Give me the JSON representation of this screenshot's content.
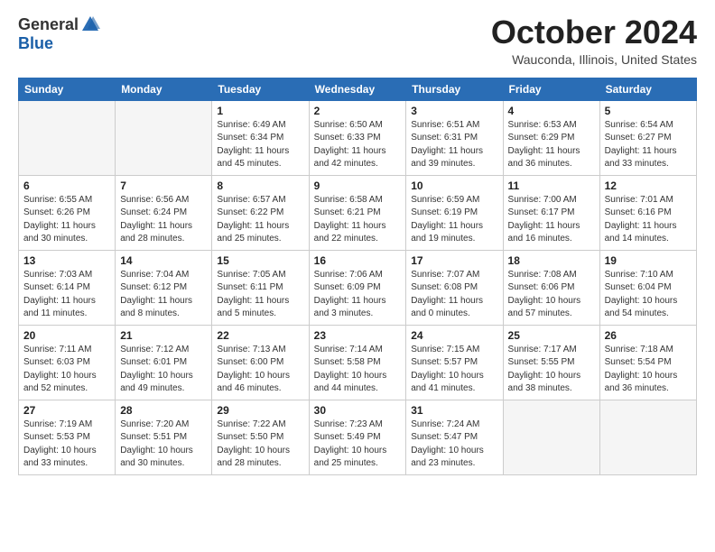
{
  "header": {
    "logo_general": "General",
    "logo_blue": "Blue",
    "month": "October 2024",
    "location": "Wauconda, Illinois, United States"
  },
  "days_of_week": [
    "Sunday",
    "Monday",
    "Tuesday",
    "Wednesday",
    "Thursday",
    "Friday",
    "Saturday"
  ],
  "weeks": [
    [
      {
        "day": "",
        "empty": true
      },
      {
        "day": "",
        "empty": true
      },
      {
        "day": "1",
        "sunrise": "Sunrise: 6:49 AM",
        "sunset": "Sunset: 6:34 PM",
        "daylight": "Daylight: 11 hours and 45 minutes."
      },
      {
        "day": "2",
        "sunrise": "Sunrise: 6:50 AM",
        "sunset": "Sunset: 6:33 PM",
        "daylight": "Daylight: 11 hours and 42 minutes."
      },
      {
        "day": "3",
        "sunrise": "Sunrise: 6:51 AM",
        "sunset": "Sunset: 6:31 PM",
        "daylight": "Daylight: 11 hours and 39 minutes."
      },
      {
        "day": "4",
        "sunrise": "Sunrise: 6:53 AM",
        "sunset": "Sunset: 6:29 PM",
        "daylight": "Daylight: 11 hours and 36 minutes."
      },
      {
        "day": "5",
        "sunrise": "Sunrise: 6:54 AM",
        "sunset": "Sunset: 6:27 PM",
        "daylight": "Daylight: 11 hours and 33 minutes."
      }
    ],
    [
      {
        "day": "6",
        "sunrise": "Sunrise: 6:55 AM",
        "sunset": "Sunset: 6:26 PM",
        "daylight": "Daylight: 11 hours and 30 minutes."
      },
      {
        "day": "7",
        "sunrise": "Sunrise: 6:56 AM",
        "sunset": "Sunset: 6:24 PM",
        "daylight": "Daylight: 11 hours and 28 minutes."
      },
      {
        "day": "8",
        "sunrise": "Sunrise: 6:57 AM",
        "sunset": "Sunset: 6:22 PM",
        "daylight": "Daylight: 11 hours and 25 minutes."
      },
      {
        "day": "9",
        "sunrise": "Sunrise: 6:58 AM",
        "sunset": "Sunset: 6:21 PM",
        "daylight": "Daylight: 11 hours and 22 minutes."
      },
      {
        "day": "10",
        "sunrise": "Sunrise: 6:59 AM",
        "sunset": "Sunset: 6:19 PM",
        "daylight": "Daylight: 11 hours and 19 minutes."
      },
      {
        "day": "11",
        "sunrise": "Sunrise: 7:00 AM",
        "sunset": "Sunset: 6:17 PM",
        "daylight": "Daylight: 11 hours and 16 minutes."
      },
      {
        "day": "12",
        "sunrise": "Sunrise: 7:01 AM",
        "sunset": "Sunset: 6:16 PM",
        "daylight": "Daylight: 11 hours and 14 minutes."
      }
    ],
    [
      {
        "day": "13",
        "sunrise": "Sunrise: 7:03 AM",
        "sunset": "Sunset: 6:14 PM",
        "daylight": "Daylight: 11 hours and 11 minutes."
      },
      {
        "day": "14",
        "sunrise": "Sunrise: 7:04 AM",
        "sunset": "Sunset: 6:12 PM",
        "daylight": "Daylight: 11 hours and 8 minutes."
      },
      {
        "day": "15",
        "sunrise": "Sunrise: 7:05 AM",
        "sunset": "Sunset: 6:11 PM",
        "daylight": "Daylight: 11 hours and 5 minutes."
      },
      {
        "day": "16",
        "sunrise": "Sunrise: 7:06 AM",
        "sunset": "Sunset: 6:09 PM",
        "daylight": "Daylight: 11 hours and 3 minutes."
      },
      {
        "day": "17",
        "sunrise": "Sunrise: 7:07 AM",
        "sunset": "Sunset: 6:08 PM",
        "daylight": "Daylight: 11 hours and 0 minutes."
      },
      {
        "day": "18",
        "sunrise": "Sunrise: 7:08 AM",
        "sunset": "Sunset: 6:06 PM",
        "daylight": "Daylight: 10 hours and 57 minutes."
      },
      {
        "day": "19",
        "sunrise": "Sunrise: 7:10 AM",
        "sunset": "Sunset: 6:04 PM",
        "daylight": "Daylight: 10 hours and 54 minutes."
      }
    ],
    [
      {
        "day": "20",
        "sunrise": "Sunrise: 7:11 AM",
        "sunset": "Sunset: 6:03 PM",
        "daylight": "Daylight: 10 hours and 52 minutes."
      },
      {
        "day": "21",
        "sunrise": "Sunrise: 7:12 AM",
        "sunset": "Sunset: 6:01 PM",
        "daylight": "Daylight: 10 hours and 49 minutes."
      },
      {
        "day": "22",
        "sunrise": "Sunrise: 7:13 AM",
        "sunset": "Sunset: 6:00 PM",
        "daylight": "Daylight: 10 hours and 46 minutes."
      },
      {
        "day": "23",
        "sunrise": "Sunrise: 7:14 AM",
        "sunset": "Sunset: 5:58 PM",
        "daylight": "Daylight: 10 hours and 44 minutes."
      },
      {
        "day": "24",
        "sunrise": "Sunrise: 7:15 AM",
        "sunset": "Sunset: 5:57 PM",
        "daylight": "Daylight: 10 hours and 41 minutes."
      },
      {
        "day": "25",
        "sunrise": "Sunrise: 7:17 AM",
        "sunset": "Sunset: 5:55 PM",
        "daylight": "Daylight: 10 hours and 38 minutes."
      },
      {
        "day": "26",
        "sunrise": "Sunrise: 7:18 AM",
        "sunset": "Sunset: 5:54 PM",
        "daylight": "Daylight: 10 hours and 36 minutes."
      }
    ],
    [
      {
        "day": "27",
        "sunrise": "Sunrise: 7:19 AM",
        "sunset": "Sunset: 5:53 PM",
        "daylight": "Daylight: 10 hours and 33 minutes."
      },
      {
        "day": "28",
        "sunrise": "Sunrise: 7:20 AM",
        "sunset": "Sunset: 5:51 PM",
        "daylight": "Daylight: 10 hours and 30 minutes."
      },
      {
        "day": "29",
        "sunrise": "Sunrise: 7:22 AM",
        "sunset": "Sunset: 5:50 PM",
        "daylight": "Daylight: 10 hours and 28 minutes."
      },
      {
        "day": "30",
        "sunrise": "Sunrise: 7:23 AM",
        "sunset": "Sunset: 5:49 PM",
        "daylight": "Daylight: 10 hours and 25 minutes."
      },
      {
        "day": "31",
        "sunrise": "Sunrise: 7:24 AM",
        "sunset": "Sunset: 5:47 PM",
        "daylight": "Daylight: 10 hours and 23 minutes."
      },
      {
        "day": "",
        "empty": true
      },
      {
        "day": "",
        "empty": true
      }
    ]
  ]
}
